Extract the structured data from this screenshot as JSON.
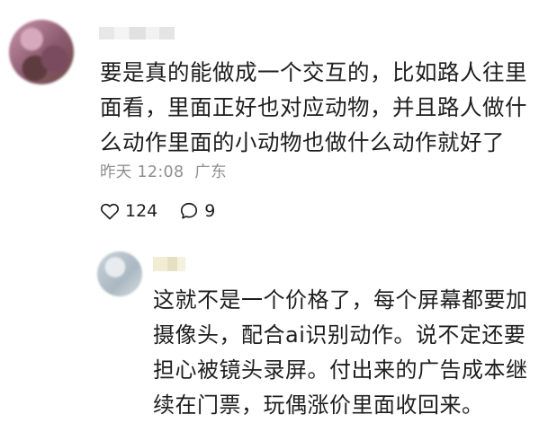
{
  "comment": {
    "text": "要是真的能做成一个交互的，比如路人往里\n面看，里面正好也对应动物，并且路人做什\n么动作里面的小动物也做什么动作就好了",
    "time": "昨天 12:08",
    "location": "广东",
    "likes": "124",
    "replies": "9"
  },
  "reply": {
    "text": "这就不是一个价格了，每个屏幕都要加\n摄像头，配合ai识别动作。说不定还要\n担心被镜头录屏。付出来的广告成本继\n续在门票，玩偶涨价里面收回来。"
  },
  "icons": {
    "like": "heart-outline-icon",
    "comment": "speech-bubble-icon"
  }
}
